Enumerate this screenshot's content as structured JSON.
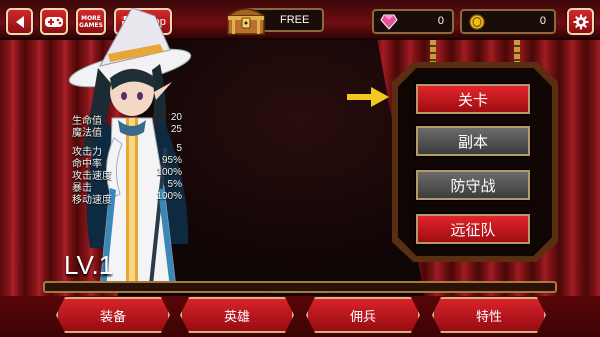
{
  "top_bar": {
    "more_games_label": [
      "MORE",
      "GAMES"
    ],
    "shop_label": "Shop",
    "chest_label": "FREE",
    "gem_count": "0",
    "coin_count": "0"
  },
  "hero": {
    "level": "LV.1",
    "stats_primary": [
      {
        "label": "生命值",
        "value": "20"
      },
      {
        "label": "魔法值",
        "value": "25"
      }
    ],
    "stats_secondary": [
      {
        "label": "攻击力",
        "value": "5"
      },
      {
        "label": "命中率",
        "value": "95%"
      },
      {
        "label": "攻击速度",
        "value": "100%"
      },
      {
        "label": "暴击",
        "value": "5%"
      },
      {
        "label": "移动速度",
        "value": "100%"
      }
    ]
  },
  "menu": {
    "items": [
      {
        "label": "关卡",
        "style": "red"
      },
      {
        "label": "副本",
        "style": "grey"
      },
      {
        "label": "防守战",
        "style": "grey"
      },
      {
        "label": "远征队",
        "style": "red"
      }
    ]
  },
  "bottom_tabs": [
    "装备",
    "英雄",
    "佣兵",
    "特性"
  ],
  "icons": {
    "back": "back-arrow-icon",
    "games": "gamepad-icon",
    "shop": "shop-stall-icon",
    "chest": "treasure-chest-icon",
    "gem": "gem-icon",
    "coin": "coin-icon",
    "settings": "gear-icon",
    "pointer": "arrow-pointer-icon"
  },
  "colors": {
    "button_red": "#d9232b",
    "button_grey": "#5a5a5a",
    "gold_border": "#d7b37a",
    "curtain_red": "#8a1418"
  }
}
